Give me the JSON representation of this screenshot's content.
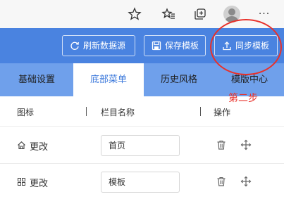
{
  "browser": {
    "icons": [
      "star-icon",
      "favorites-icon",
      "collections-icon",
      "profile-icon",
      "more-icon"
    ],
    "more_label": "···"
  },
  "toolbar": {
    "refresh_label": "刷新数据源",
    "save_label": "保存模板",
    "sync_label": "同步模板"
  },
  "tabs": [
    {
      "label": "基础设置",
      "active": false
    },
    {
      "label": "底部菜单",
      "active": true
    },
    {
      "label": "历史风格",
      "active": false
    },
    {
      "label": "模版中心",
      "active": false
    }
  ],
  "table": {
    "headers": [
      "图标",
      "栏目名称",
      "操作"
    ],
    "rows": [
      {
        "icon": "home-icon",
        "icon_label": "更改",
        "name": "首页"
      },
      {
        "icon": "grid-icon",
        "icon_label": "更改",
        "name": "模板"
      }
    ]
  },
  "annotation": {
    "text": "第二步",
    "color": "#e8312b"
  },
  "colors": {
    "primary": "#4a83e0",
    "tab_bar": "#6fa0eb",
    "active_tab_text": "#3b78db"
  }
}
